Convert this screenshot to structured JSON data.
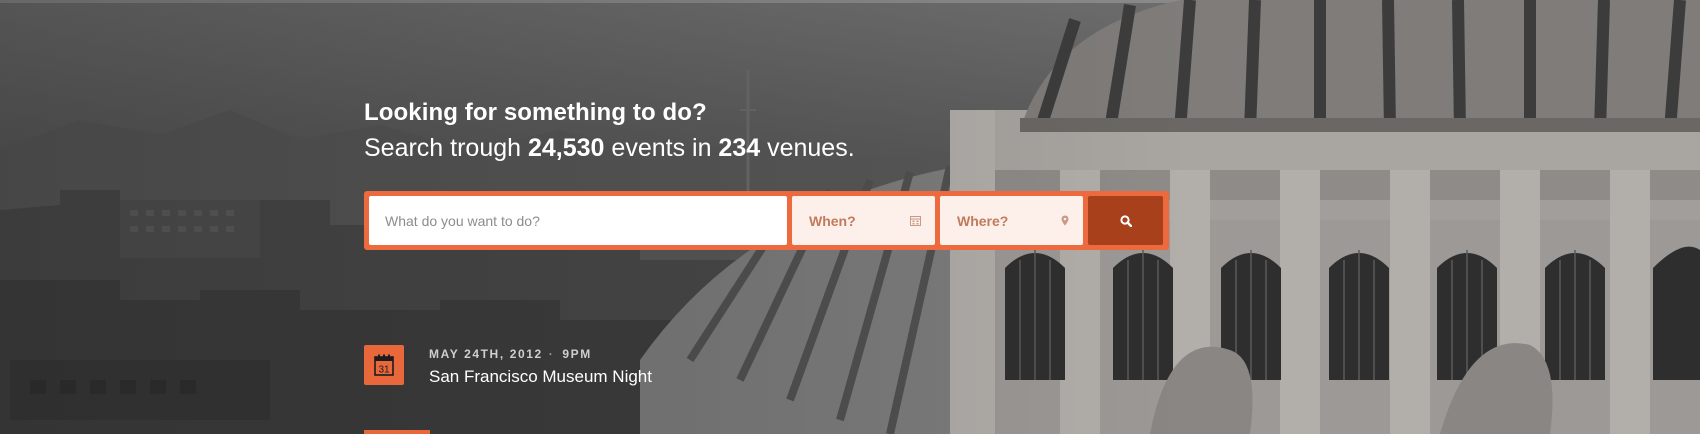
{
  "hero": {
    "headline": "Looking for something to do?",
    "subline_prefix": "Search trough ",
    "events_count": "24,530",
    "subline_middle": " events in ",
    "venues_count": "234",
    "subline_suffix": " venues."
  },
  "search": {
    "what_placeholder": "What do you want to do?",
    "when_placeholder": "When?",
    "where_placeholder": "Where?",
    "when_icon": "calendar-icon",
    "where_icon": "map-pin-icon",
    "button_icon": "search-icon"
  },
  "event": {
    "icon": "calendar-icon",
    "calendar_day": "31",
    "date": "MAY 24TH, 2012",
    "time": "9PM",
    "title": "San Francisco Museum Night"
  },
  "colors": {
    "accent": "#ec6a3d",
    "button_dark": "#a8401c",
    "field_tint": "#fdf0ea"
  }
}
